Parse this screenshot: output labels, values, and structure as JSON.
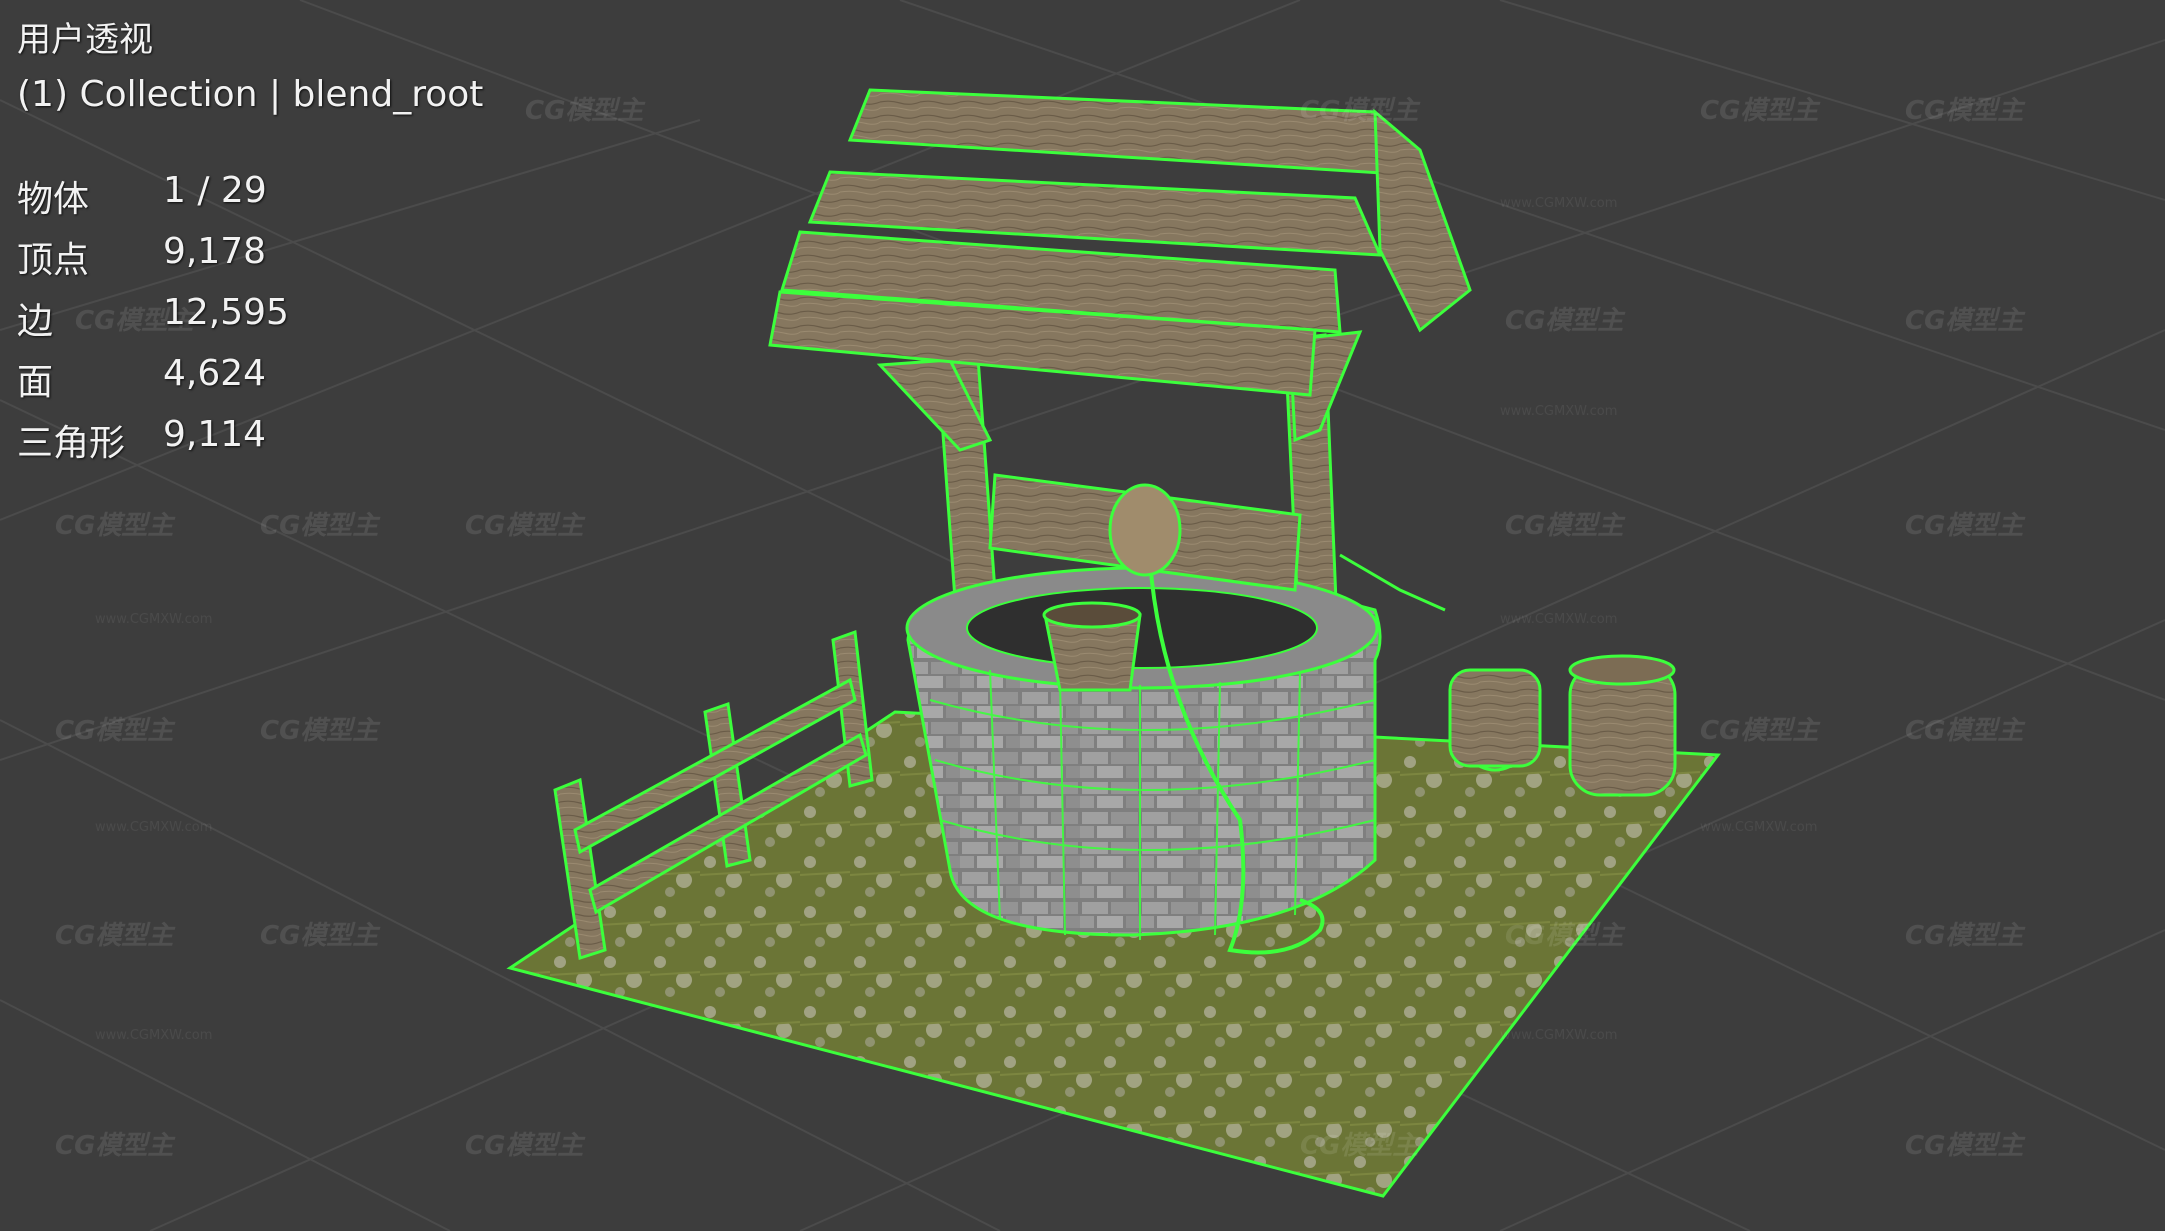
{
  "viewport": {
    "view_name": "用户透视",
    "collection": "(1) Collection | blend_root"
  },
  "stats": [
    {
      "label": "物体",
      "value": "1 / 29"
    },
    {
      "label": "顶点",
      "value": "9,178"
    },
    {
      "label": "边",
      "value": "12,595"
    },
    {
      "label": "面",
      "value": "4,624"
    },
    {
      "label": "三角形",
      "value": "9,114"
    }
  ],
  "watermark": {
    "logo": "CG模型主",
    "url": "www.CGMXW.com"
  },
  "colors": {
    "background": "#3d3d3d",
    "grid": "#4a4a4a",
    "selection_wire": "#3cff3c",
    "wood": "#8a7a62",
    "stone": "#9a9a9a",
    "grass": "#6f7a3a"
  }
}
